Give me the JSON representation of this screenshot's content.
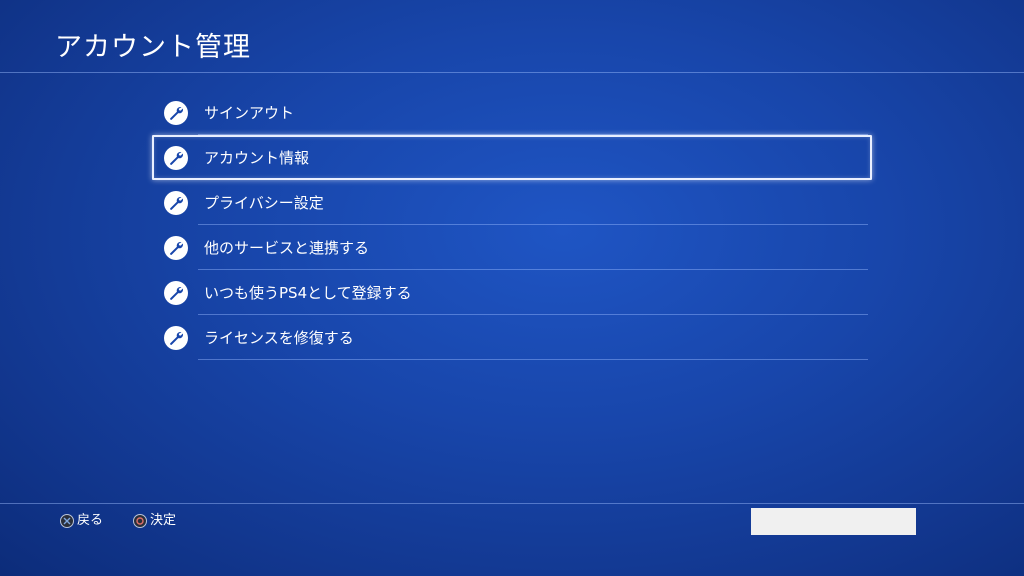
{
  "header": {
    "title": "アカウント管理"
  },
  "menu": {
    "selected_index": 1,
    "items": [
      {
        "label": "サインアウト",
        "icon": "wrench-icon"
      },
      {
        "label": "アカウント情報",
        "icon": "wrench-icon"
      },
      {
        "label": "プライバシー設定",
        "icon": "wrench-icon"
      },
      {
        "label": "他のサービスと連携する",
        "icon": "wrench-icon"
      },
      {
        "label": "いつも使うPS4として登録する",
        "icon": "wrench-icon"
      },
      {
        "label": "ライセンスを修復する",
        "icon": "wrench-icon"
      }
    ]
  },
  "footer": {
    "back_label": "戻る",
    "back_icon": "cross-button-icon",
    "confirm_label": "決定",
    "confirm_icon": "circle-button-icon"
  },
  "colors": {
    "background": "#1846ab",
    "text": "#ffffff",
    "selection_border": "#e9efff",
    "cross_symbol": "#7fa7e0",
    "circle_symbol": "#e0706a"
  }
}
